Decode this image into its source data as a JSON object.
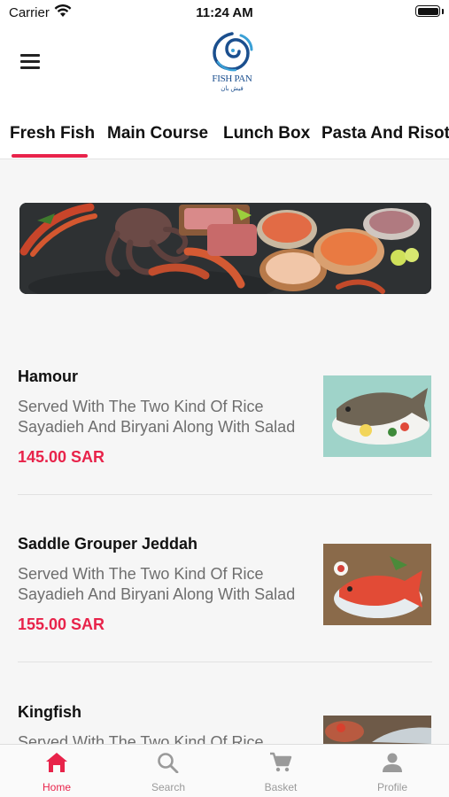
{
  "status_bar": {
    "carrier": "Carrier",
    "time": "11:24 AM"
  },
  "brand": {
    "name": "FISH PAN",
    "name_arabic": "فيش بان"
  },
  "colors": {
    "accent": "#e8234a",
    "brand_blue": "#1b4f8e"
  },
  "tabs": [
    {
      "label": "Fresh Fish",
      "active": true
    },
    {
      "label": "Main Course",
      "active": false
    },
    {
      "label": "Lunch Box",
      "active": false
    },
    {
      "label": "Pasta And Risotto",
      "active": false
    }
  ],
  "banner": {
    "icon": "seafood-banner-image"
  },
  "items": [
    {
      "name": "Hamour",
      "desc_line1": "Served With The Two Kind Of Rice",
      "desc_line2": "Sayadieh And Biryani Along With Salad",
      "price": "145.00 SAR",
      "image_icon": "hamour-fish-image"
    },
    {
      "name": "Saddle Grouper Jeddah",
      "desc_line1": "Served With The Two Kind Of Rice",
      "desc_line2": "Sayadieh And Biryani Along With Salad",
      "price": "155.00 SAR",
      "image_icon": "grouper-fish-image"
    },
    {
      "name": "Kingfish",
      "desc_line1": "Served With The Two Kind Of Rice",
      "desc_line2": "",
      "price": "",
      "image_icon": "kingfish-image"
    }
  ],
  "bottom_nav": [
    {
      "label": "Home",
      "icon": "home-icon",
      "active": true
    },
    {
      "label": "Search",
      "icon": "search-icon",
      "active": false
    },
    {
      "label": "Basket",
      "icon": "cart-icon",
      "active": false
    },
    {
      "label": "Profile",
      "icon": "profile-icon",
      "active": false
    }
  ]
}
